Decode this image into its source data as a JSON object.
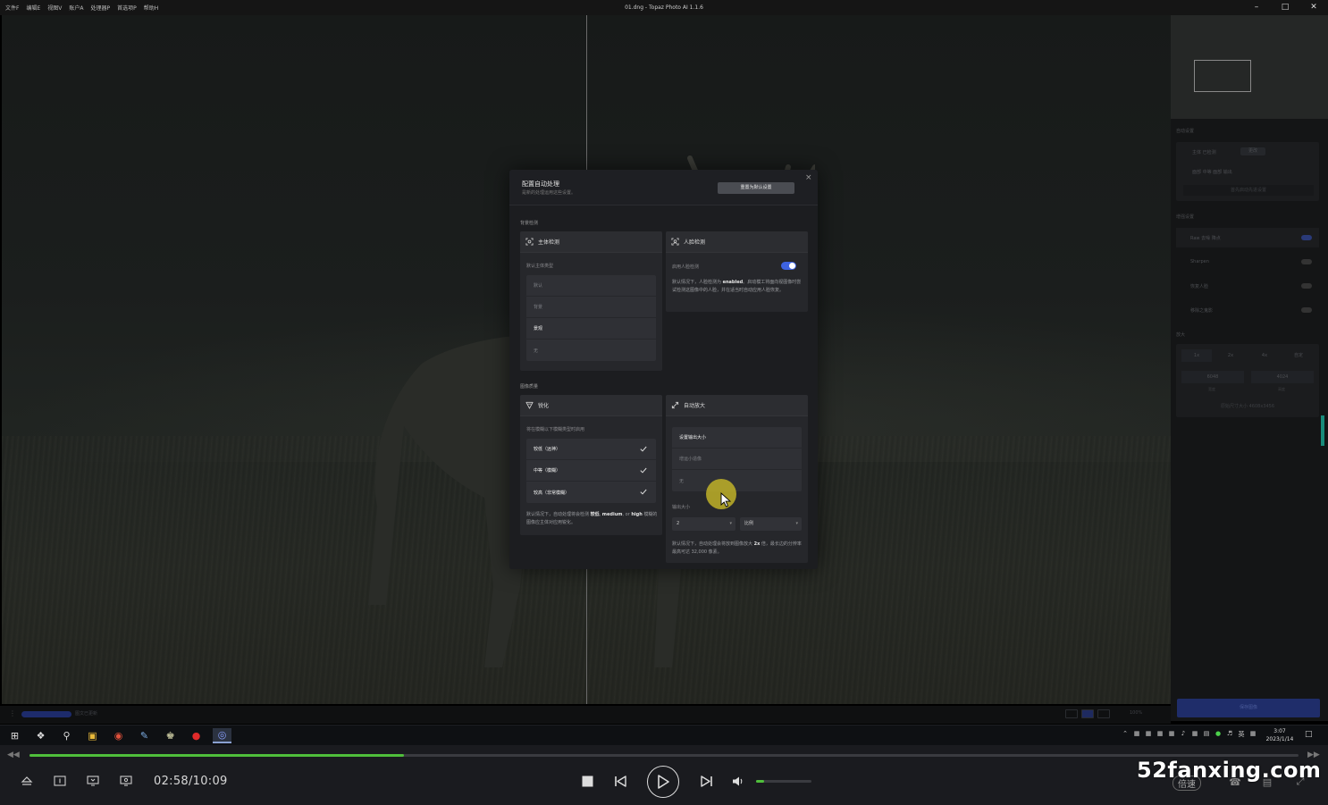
{
  "app": {
    "title": "01.dng - Topaz Photo AI 1.1.6",
    "menu": [
      "文件F",
      "编辑E",
      "视图V",
      "账户A",
      "处理器P",
      "首选项P",
      "帮助H"
    ]
  },
  "dialog": {
    "title": "配置自动处理",
    "subtitle": "是新的处理运用这些设置。",
    "reset_label": "重置为默认设置",
    "section_detection": "背景检测",
    "section_quality": "图像质量",
    "subject": {
      "title": "主体检测",
      "label": "默认主体类型",
      "options": [
        "默认",
        "背景",
        "景观",
        "无"
      ],
      "selected": 2
    },
    "face": {
      "title": "人脸检测",
      "toggle_label": "启用人脸检测",
      "toggle_on": true,
      "desc_a": "默认情况下，人脸检测为 ",
      "desc_b": "enabled",
      "desc_c": "。启动模工将面向视图像时尝试检测这图像中的人脸，并在适当时自动应用人脸恢复。"
    },
    "sharpen": {
      "title": "锐化",
      "label": "将在模糊以下模糊类型时启用",
      "options": [
        "较低（远神）",
        "中等（模糊）",
        "较高（非常模糊）"
      ],
      "desc_a": "默认情况下，自动处理将会检测 ",
      "desc_b1": "较低",
      "desc_sep": ", ",
      "desc_b2": "medium",
      "desc_or": ", or ",
      "desc_b3": "high",
      "desc_c": " 模糊的图像应主体对应用锐化。"
    },
    "upscale": {
      "title": "自动放大",
      "options": [
        "设置输出大小",
        "增运小造像",
        "无"
      ],
      "selected": 0,
      "output_label": "输出大小",
      "scale_value": "2",
      "mode_value": "比例",
      "desc_a": "默认情况下，自动处理会将放到图像放大 ",
      "desc_b": "2x",
      "desc_c": " 倍，最长边的分辨率最高可达 32,000 像素。"
    }
  },
  "right_panel": {
    "section_1": "自动设置",
    "row_subject": "主体 已检测",
    "row_subject_btn": "更改",
    "row_face": "面部 中等 面部 输出",
    "row_hint": "首先启动先进设置",
    "section_2": "增强设置",
    "row_raw": "Raw 去噪 降点",
    "row_sharpen": "Sharpen",
    "row_recover": "恢复人脸",
    "row_enhance": "移除之鬼影",
    "section_3": "放大",
    "scale_opts": [
      "1x",
      "2x",
      "4x",
      "自定"
    ],
    "width": "6048",
    "height": "4024",
    "w_label": "宽度",
    "h_label": "高度",
    "footer": "原始尺寸大小 4608x3456",
    "save_label": "保存图像"
  },
  "status": {
    "text": "图文已更新",
    "zoom": "100%"
  },
  "taskbar": {
    "time": "3:07",
    "date": "2023/1/14",
    "ime": "英"
  },
  "player": {
    "time": "02:58/10:09",
    "progress": 0.295,
    "volume": 0.15,
    "speed_label": "倍速",
    "watermark": "52fanxing.com"
  },
  "colors": {
    "accent": "#3e63e0",
    "progress": "#4fbf3b"
  }
}
